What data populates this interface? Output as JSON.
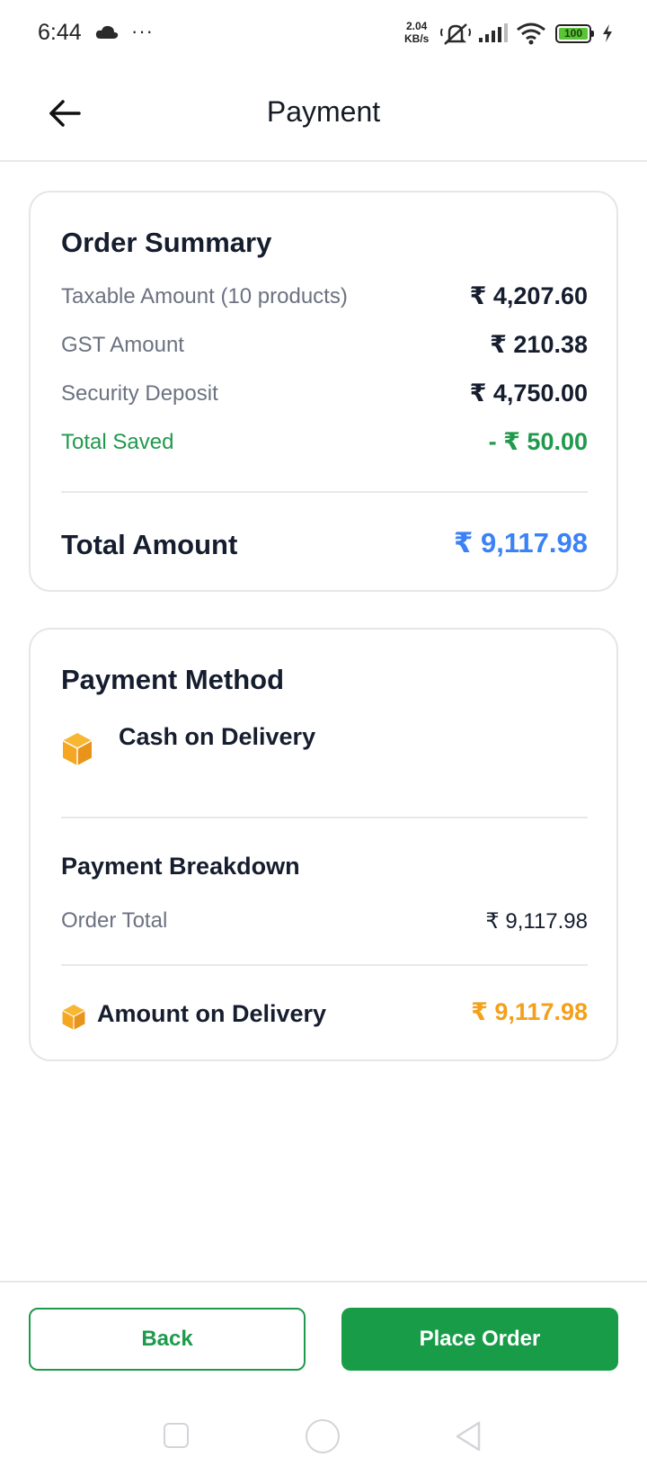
{
  "status_bar": {
    "time": "6:44",
    "more": "···",
    "net_speed_value": "2.04",
    "net_speed_unit": "KB/s",
    "battery": "100"
  },
  "header": {
    "title": "Payment"
  },
  "order_summary": {
    "heading": "Order Summary",
    "rows": [
      {
        "label": "Taxable Amount (10 products)",
        "value": "₹ 4,207.60"
      },
      {
        "label": "GST Amount",
        "value": "₹ 210.38"
      },
      {
        "label": "Security Deposit",
        "value": "₹ 4,750.00"
      },
      {
        "label": "Total Saved",
        "value": "- ₹ 50.00"
      }
    ],
    "total_label": "Total Amount",
    "total_value": "₹ 9,117.98"
  },
  "payment_method": {
    "heading": "Payment Method",
    "method_name": "Cash on Delivery",
    "breakdown_heading": "Payment Breakdown",
    "order_total_label": "Order Total",
    "order_total_value": "₹ 9,117.98",
    "delivery_label": "Amount on Delivery",
    "delivery_value": "₹ 9,117.98"
  },
  "footer": {
    "back_label": "Back",
    "place_order_label": "Place Order"
  },
  "colors": {
    "primary_green": "#189c48",
    "total_blue": "#3b82f6",
    "delivery_orange": "#f3a01b",
    "box_icon": "#f5a623"
  },
  "icons": [
    "cloud-icon",
    "mute-icon",
    "signal-icon",
    "wifi-icon",
    "battery-icon",
    "charge-icon",
    "back-arrow-icon",
    "box-icon"
  ]
}
